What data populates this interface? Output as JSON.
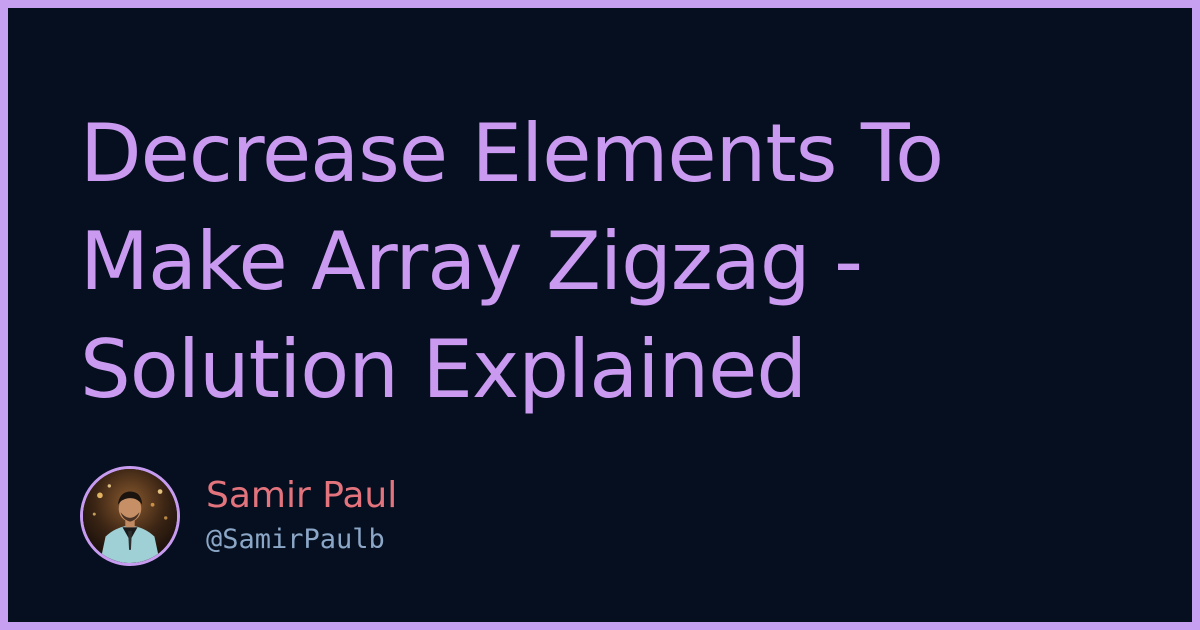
{
  "title": {
    "lines": [
      "Decrease Elements To",
      "Make Array Zigzag -",
      "Solution Explained"
    ]
  },
  "author": {
    "name": "Samir Paul",
    "handle": "@SamirPaulb",
    "avatar_icon": "user-photo-avatar"
  },
  "colors": {
    "background": "#060f1f",
    "border": "#c8a0f2",
    "title": "#c99af0",
    "name": "#e3747d",
    "handle": "#8ba6c6"
  }
}
